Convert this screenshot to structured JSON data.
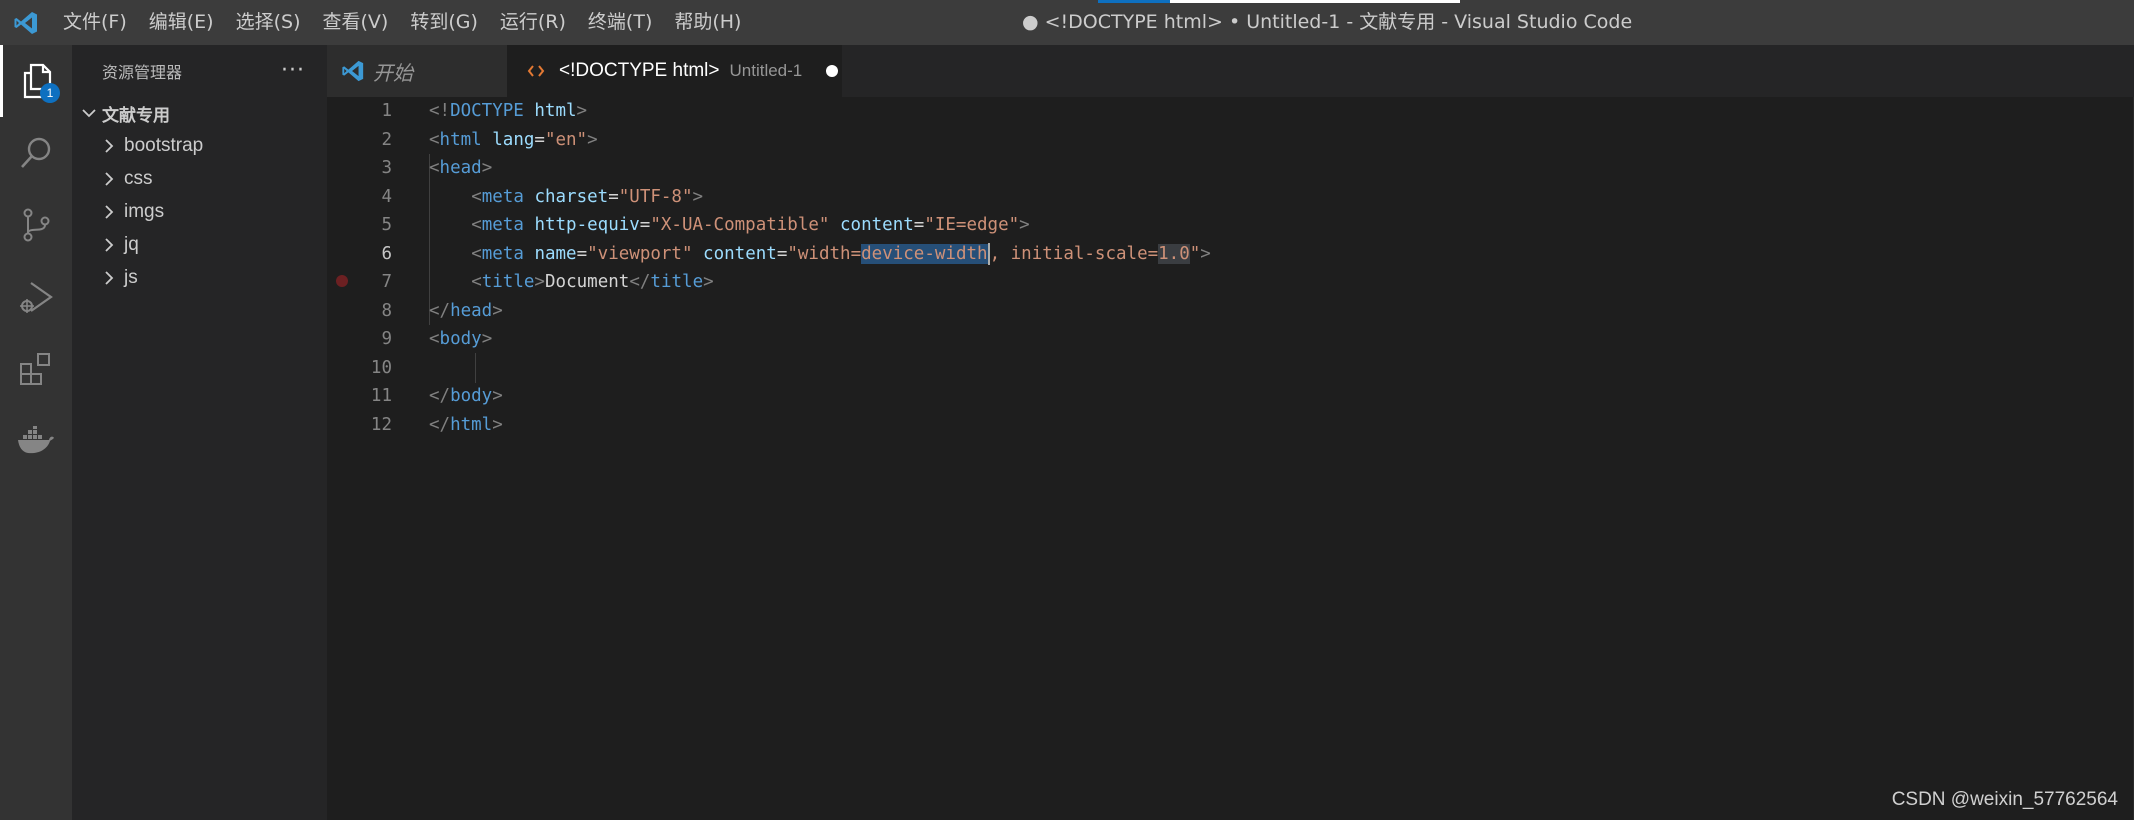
{
  "titlebar": {
    "menu": [
      "文件(F)",
      "编辑(E)",
      "选择(S)",
      "查看(V)",
      "转到(G)",
      "运行(R)",
      "终端(T)",
      "帮助(H)"
    ],
    "window_title": "● <!DOCTYPE html> • Untitled-1 - 文献专用 - Visual Studio Code"
  },
  "activitybar": {
    "items": [
      "explorer-icon",
      "search-icon",
      "source-control-icon",
      "run-debug-icon",
      "extensions-icon",
      "docker-icon"
    ],
    "explorer_badge": "1"
  },
  "sidebar": {
    "title": "资源管理器",
    "folder": "文献专用",
    "items": [
      "bootstrap",
      "css",
      "imgs",
      "jq",
      "js"
    ]
  },
  "tabs": {
    "welcome": "开始",
    "editor_label": "<!DOCTYPE html>",
    "editor_desc": "Untitled-1"
  },
  "editor": {
    "line_numbers": [
      "1",
      "2",
      "3",
      "4",
      "5",
      "6",
      "7",
      "8",
      "9",
      "10",
      "11",
      "12"
    ],
    "current_line": "6",
    "lines": [
      "<!DOCTYPE html>",
      "<html lang=\"en\">",
      "<head>",
      "    <meta charset=\"UTF-8\">",
      "    <meta http-equiv=\"X-UA-Compatible\" content=\"IE=edge\">",
      "    <meta name=\"viewport\" content=\"width=device-width, initial-scale=1.0\">",
      "    <title>Document</title>",
      "</head>",
      "<body>",
      "",
      "</body>",
      "</html>"
    ]
  },
  "watermark": "CSDN @weixin_57762564",
  "colors": {
    "tag": "#569cd6",
    "attribute": "#9cdcfe",
    "string": "#ce9178",
    "punctuation": "#808080",
    "accent": "#0e70c0"
  }
}
